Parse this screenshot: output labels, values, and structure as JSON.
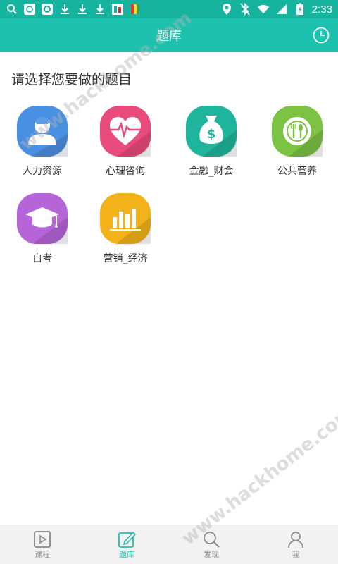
{
  "status_bar": {
    "time": "2:33"
  },
  "header": {
    "title": "题库"
  },
  "main": {
    "prompt": "请选择您要做的题目",
    "categories": [
      {
        "label": "人力资源",
        "icon": "person-icon",
        "color": "#4a90e2"
      },
      {
        "label": "心理咨询",
        "icon": "heart-pulse-icon",
        "color": "#e94c7c"
      },
      {
        "label": "金融_财会",
        "icon": "money-bag-icon",
        "color": "#1eb59c"
      },
      {
        "label": "公共营养",
        "icon": "plate-utensils-icon",
        "color": "#7cc243"
      },
      {
        "label": "自考",
        "icon": "graduation-cap-icon",
        "color": "#b565d8"
      },
      {
        "label": "营销_经济",
        "icon": "bar-chart-icon",
        "color": "#f3b21a"
      }
    ]
  },
  "bottom_nav": [
    {
      "label": "课程",
      "icon": "play-icon",
      "active": false
    },
    {
      "label": "题库",
      "icon": "edit-icon",
      "active": true
    },
    {
      "label": "发现",
      "icon": "search-icon",
      "active": false
    },
    {
      "label": "我",
      "icon": "user-icon",
      "active": false
    }
  ],
  "watermark": "www.hackhome.com",
  "colors": {
    "accent": "#1ec1ad",
    "status_bar": "#16b39f"
  }
}
